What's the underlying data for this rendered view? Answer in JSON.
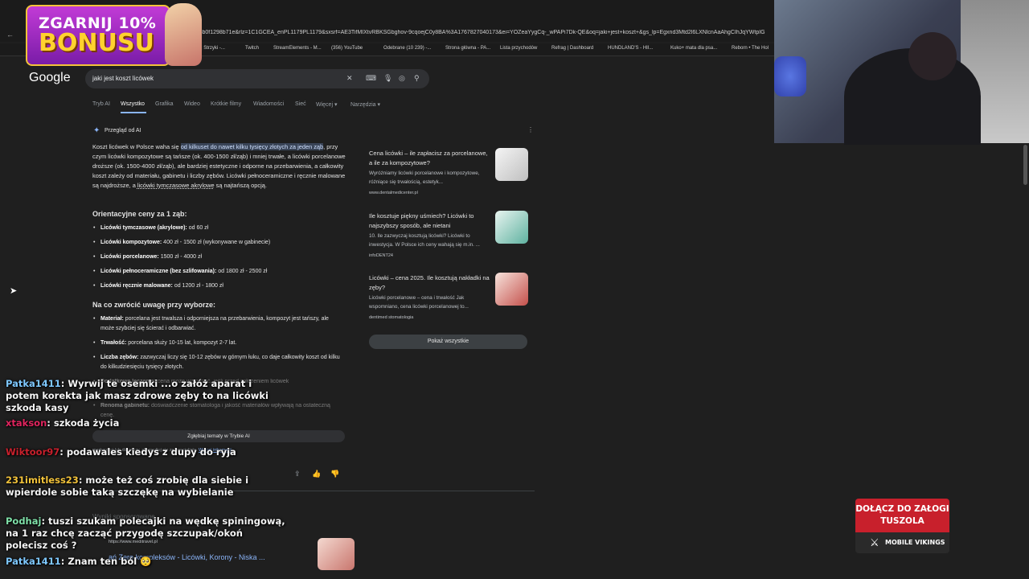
{
  "browser": {
    "url": "512b3b0f1298b71e&rlz=1C1GCEA_enPL1179PL1179&sxsrf=AE3TifMIXtvRBKSGbghov-9cqoejC0y8BA%3A1767827040173&ei=YOZeaYygCq-_wPAPi7Dk-QE&oq=jaki+jest+koszt+&gs_lp=Egxnd3Mtd2l6LXNlcnAaAhgCIhJqYWtpIG",
    "bookmarks": [
      "| Strzyki -...",
      "Twitch",
      "StreamElements - M...",
      "(356) YouTube",
      "Odebrane (10 239) -...",
      "Strona główna - PA...",
      "Lista przychodów",
      "Refrag | Dashboard",
      "HUNDLAND'S - HII...",
      "Kuko+ mata dla psa...",
      "Reborn • The Hol"
    ]
  },
  "bonus": {
    "line1": "ZGARNIJ 10%",
    "line2": "BONUSU"
  },
  "google": {
    "logo": "Google",
    "query": "jaki jest koszt licówek",
    "tabs": [
      "Tryb AI",
      "Wszystko",
      "Grafika",
      "Wideo",
      "Krótkie filmy",
      "Wiadomości",
      "Sieć",
      "Więcej ▾",
      "Narzędzia ▾"
    ],
    "ai_title": "Przegląd od AI",
    "intro": {
      "p1": "Koszt licówek w Polsce waha się ",
      "hl1": "od kilkuset do nawet kilku tysięcy złotych za jeden ząb",
      "p2": ", przy czym licówki kompozytowe są tańsze (ok. 400-1500 zł/ząb) i mniej trwałe, a licówki porcelanowe droższe (ok. 1500-4000 zł/ząb), ale bardziej estetyczne i odporne na przebarwienia, a całkowity koszt zależy od materiału, gabinetu i liczby zębów. Licówki pełnoceramiczne i ręcznie malowane są najdroższe, a ",
      "ul1": "licówki tymczasowe akrylowe",
      "p3": " są najtańszą opcją."
    },
    "h_prices": "Orientacyjne ceny za 1 ząb:",
    "prices": [
      {
        "name": "Licówki tymczasowe (akrylowe):",
        "val": " od 60 zł"
      },
      {
        "name": "Licówki kompozytowe:",
        "val": " 400 zł - 1500 zł (wykonywane w gabinecie)"
      },
      {
        "name": "Licówki porcelanowe:",
        "val": " 1500 zł - 4000 zł"
      },
      {
        "name": "Licówki pełnoceramiczne (bez szlifowania):",
        "val": " od 1800 zł - 2500 zł"
      },
      {
        "name": "Licówki ręcznie malowane:",
        "val": " od 1200 zł - 1800 zł"
      }
    ],
    "h_attention": "Na co zwrócić uwagę przy wyborze:",
    "attention": [
      {
        "name": "Materiał:",
        "val": " porcelana jest trwalsza i odporniejsza na przebarwienia, kompozyt jest tańszy, ale może szybciej się ścierać i odbarwiać."
      },
      {
        "name": "Trwałość:",
        "val": " porcelana służy 10-15 lat, kompozyt 2-7 lat."
      },
      {
        "name": "Liczba zębów:",
        "val": " zazwyczaj liczy się 10-12 zębów w górnym łuku, co daje całkowity koszt od kilku do kilkudziesięciu tysięcy złotych."
      },
      {
        "name": "Dodatkowe leczenie:",
        "val": " cena może wzrosnąć, jeśli przed założeniem licówek"
      },
      {
        "name": "Renoma gabinetu:",
        "val": " doświadczenie stomatologa i jakość materiałów wpływają na ostateczną cenę."
      }
    ],
    "cards": [
      {
        "title": "Cena licówki – ile zapłacisz za porcelanowe, a ile za kompozytowe?",
        "desc": "Wyróżniamy licówki porcelanowe i kompozytowe, różniące się trwałością, estetyk...",
        "src": "www.dentalmedicenter.pl"
      },
      {
        "title": "Ile kosztuje piękny uśmiech? Licówki to najszybszy sposób, ale nietani",
        "desc": "10. Ile zazwyczaj kosztują licówki? Licówki to inwestycja. W Polsce ich ceny wahają się m.in. ...",
        "src": "infoDENT24"
      },
      {
        "title": "Licówki – cena 2025. Ile kosztują nakładki na zęby?",
        "desc": "Licówki porcelanowe – cena i trwałość Jak wspomniano, cena licówki porcelanowej to...",
        "src": "dentimed stomatologia"
      }
    ],
    "show_all": "Pokaż wszystkie",
    "deeper": "Zgłębiaj tematy w Trybie AI",
    "disclaimer": "medycznej lub diagnozy, skonsultuj się ze specjalistą.",
    "more_info": "Więcej informacji",
    "related": "Wyniki sponsorowane",
    "result_site": "https://www.meditravel.pl",
    "result_title": "ań Zero kompleksów - Licówki, Korony - Niska ..."
  },
  "chat": [
    {
      "user": "Patka1411",
      "color": "#7ec8ff",
      "msg": ": Wyrwij te osemki ...o załóż aparat i potem korekta jak masz zdrowe zęby to na licówki szkoda kasy"
    },
    {
      "user": "xtakson",
      "color": "#e0245e",
      "msg": ": szkoda życia"
    },
    {
      "user": "Wiktoor97",
      "color": "#c8202c",
      "msg": ": podawales kiedys z dupy do ryja"
    },
    {
      "user": "231imitless23",
      "color": "#f3c33a",
      "msg": ": może też coś zrobię dla siebie i wpierdole sobie taką szczękę na wybielanie"
    },
    {
      "user": "Podhaj",
      "color": "#7fe0a8",
      "msg": ": tuszi szukam polecajki na wędkę spiningową, na 1 raz chcę zacząć przygodę szczupak/okoń polecisz coś ?"
    },
    {
      "user": "Patka1411",
      "color": "#7ec8ff",
      "msg": ": Znam ten ból 🥺"
    }
  ],
  "promo": {
    "line1": "DOŁĄCZ DO ZAŁOGI",
    "line2": "TUSZOLA",
    "brand": "MOBILE VIKINGS"
  }
}
